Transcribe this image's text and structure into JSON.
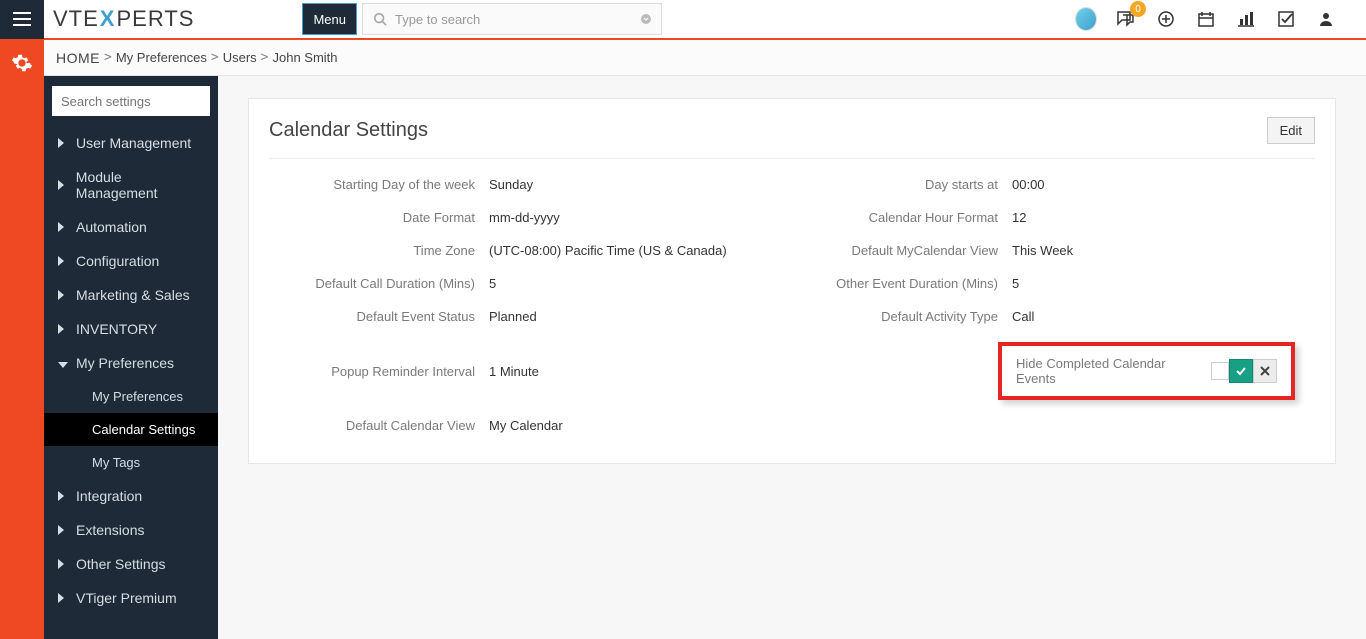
{
  "header": {
    "logo_pre": "VTE",
    "logo_x": "X",
    "logo_post": "PERTS",
    "menu_label": "Menu",
    "search_placeholder": "Type to search",
    "notification_count": "0"
  },
  "breadcrumb": {
    "home": "HOME",
    "items": [
      "My Preferences",
      "Users",
      "John Smith"
    ]
  },
  "sidebar": {
    "search_placeholder": "Search settings",
    "items": [
      {
        "label": "User Management",
        "expanded": false
      },
      {
        "label": "Module Management",
        "expanded": false
      },
      {
        "label": "Automation",
        "expanded": false
      },
      {
        "label": "Configuration",
        "expanded": false
      },
      {
        "label": "Marketing & Sales",
        "expanded": false
      },
      {
        "label": "INVENTORY",
        "expanded": false
      },
      {
        "label": "My Preferences",
        "expanded": true,
        "children": [
          {
            "label": "My Preferences",
            "active": false
          },
          {
            "label": "Calendar Settings",
            "active": true
          },
          {
            "label": "My Tags",
            "active": false
          }
        ]
      },
      {
        "label": "Integration",
        "expanded": false
      },
      {
        "label": "Extensions",
        "expanded": false
      },
      {
        "label": "Other Settings",
        "expanded": false
      },
      {
        "label": "VTiger Premium",
        "expanded": false
      }
    ]
  },
  "panel": {
    "title": "Calendar Settings",
    "edit_label": "Edit",
    "fields": {
      "starting_day_label": "Starting Day of the week",
      "starting_day_value": "Sunday",
      "day_starts_label": "Day starts at",
      "day_starts_value": "00:00",
      "date_format_label": "Date Format",
      "date_format_value": "mm-dd-yyyy",
      "hour_format_label": "Calendar Hour Format",
      "hour_format_value": "12",
      "time_zone_label": "Time Zone",
      "time_zone_value": "(UTC-08:00) Pacific Time (US & Canada)",
      "mycal_view_label": "Default MyCalendar View",
      "mycal_view_value": "This Week",
      "call_duration_label": "Default Call Duration (Mins)",
      "call_duration_value": "5",
      "other_duration_label": "Other Event Duration (Mins)",
      "other_duration_value": "5",
      "event_status_label": "Default Event Status",
      "event_status_value": "Planned",
      "activity_type_label": "Default Activity Type",
      "activity_type_value": "Call",
      "reminder_label": "Popup Reminder Interval",
      "reminder_value": "1 Minute",
      "hide_completed_label": "Hide Completed Calendar Events",
      "default_cal_view_label": "Default Calendar View",
      "default_cal_view_value": "My Calendar"
    }
  }
}
